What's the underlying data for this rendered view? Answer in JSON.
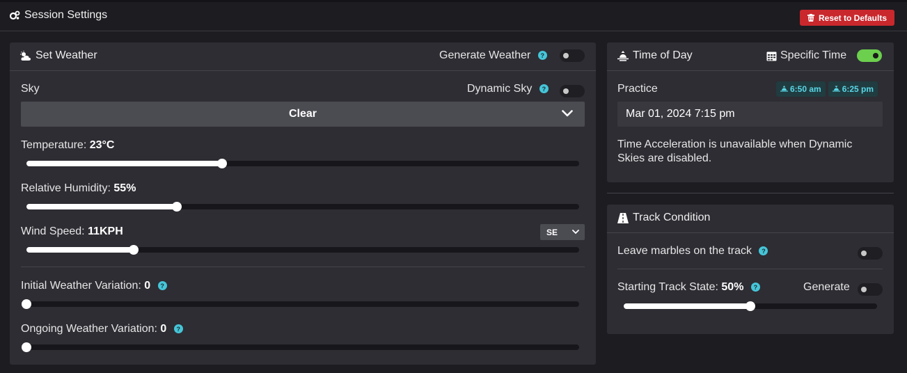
{
  "header": {
    "title": "Session Settings",
    "reset_label": "Reset to Defaults"
  },
  "weather": {
    "title": "Set Weather",
    "generate_label": "Generate Weather",
    "generate_on": false,
    "sky_label": "Sky",
    "dynamic_sky_label": "Dynamic Sky",
    "dynamic_sky_on": false,
    "sky_value": "Clear",
    "temperature_label": "Temperature:",
    "temperature_value": "23°C",
    "temperature_fraction": 0.354,
    "humidity_label": "Relative Humidity:",
    "humidity_value": "55%",
    "humidity_fraction": 0.272,
    "wind_label": "Wind Speed:",
    "wind_value": "11KPH",
    "wind_fraction": 0.194,
    "wind_direction": "SE",
    "initial_var_label": "Initial Weather Variation:",
    "initial_var_value": "0",
    "initial_var_fraction": 0,
    "ongoing_var_label": "Ongoing Weather Variation:",
    "ongoing_var_value": "0",
    "ongoing_var_fraction": 0
  },
  "time_of_day": {
    "title": "Time of Day",
    "specific_time_label": "Specific Time",
    "specific_time_on": true,
    "session_label": "Practice",
    "sunrise": "6:50 am",
    "sunset": "6:25 pm",
    "date_value": "Mar 01, 2024 7:15 pm",
    "note": "Time Acceleration is unavailable when Dynamic Skies are disabled."
  },
  "track": {
    "title": "Track Condition",
    "marbles_label": "Leave marbles on the track",
    "marbles_on": false,
    "state_label": "Starting Track State:",
    "state_value": "50%",
    "state_fraction": 0.5,
    "generate_label": "Generate",
    "generate_on": false
  },
  "colors": {
    "accent": "#46c5d8",
    "toggle_on": "#6ccf4e",
    "reset": "#c9282d"
  }
}
